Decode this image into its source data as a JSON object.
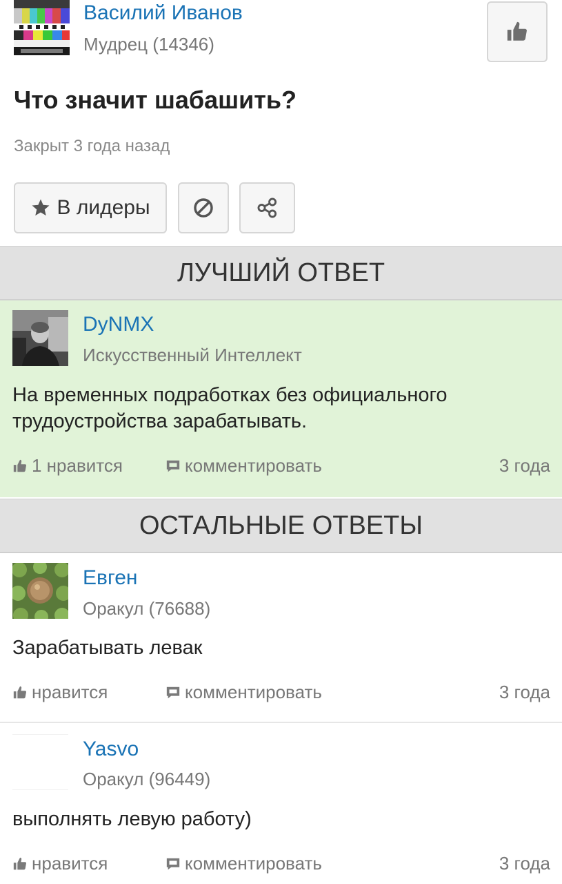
{
  "question": {
    "author": {
      "name": "Василий Иванов",
      "rank": "Мудрец (14346)",
      "avatar_icon": "tv-test-pattern-avatar"
    },
    "title": "Что значит шабашить?",
    "status": "Закрыт 3 года назад",
    "actions": {
      "leaders_label": "В лидеры",
      "leaders_icon": "star-icon",
      "block_icon": "block-icon",
      "share_icon": "share-icon"
    },
    "like_icon": "thumbs-up-icon"
  },
  "sections": {
    "best": "ЛУЧШИЙ ОТВЕТ",
    "other": "ОСТАЛЬНЫЕ ОТВЕТЫ"
  },
  "best_answer": {
    "author": {
      "name": "DyNMX",
      "rank": "Искусственный Интеллект"
    },
    "text": "На временных подработках без официального трудоустройства зарабатывать.",
    "likes": "1 нравится",
    "comment": "комментировать",
    "age": "3 года"
  },
  "answers": [
    {
      "author": {
        "name": "Евген",
        "rank": "Оракул (76688)"
      },
      "text": "Зарабатывать левак",
      "likes": "нравится",
      "comment": "комментировать",
      "age": "3 года"
    },
    {
      "author": {
        "name": "Yasvo",
        "rank": "Оракул (96449)"
      },
      "text": "выполнять левую работу)",
      "likes": "нравится",
      "comment": "комментировать",
      "age": "3 года"
    }
  ],
  "colors": {
    "link": "#1a73b5",
    "best_bg": "#e1f3d8",
    "section_bg": "#e1e1e1"
  }
}
